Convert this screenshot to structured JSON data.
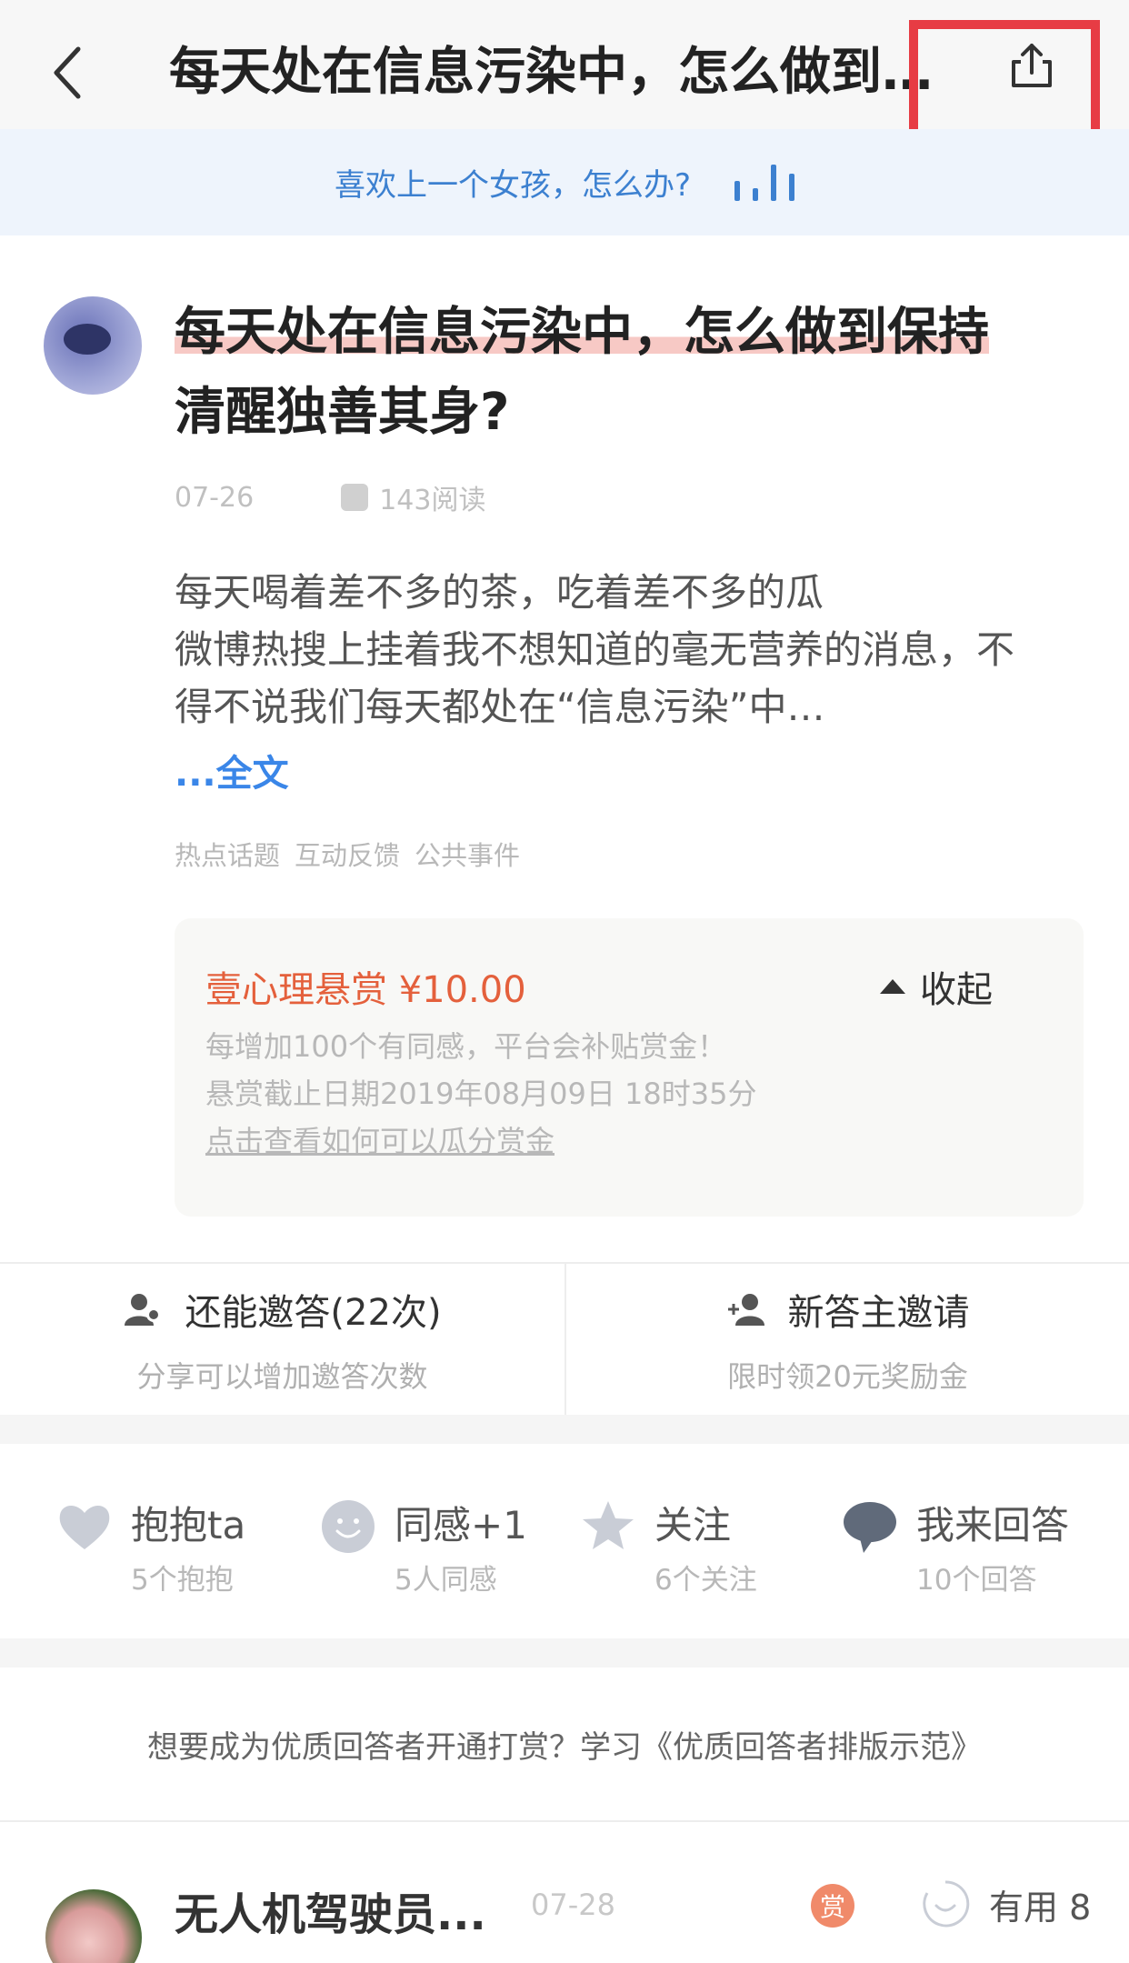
{
  "nav": {
    "title": "每天处在信息污染中，怎么做到保持清醒独善其身？",
    "back_icon": "chevron-left-icon",
    "share_icon": "share-icon",
    "highlight_color": "#e73c44"
  },
  "banner": {
    "text": "喜欢上一个女孩，怎么办?",
    "icon": "audio-bars-icon"
  },
  "question": {
    "title_line1": "每天处在信息污染中，怎么做到保持",
    "title_line2": "清醒独善其身?",
    "date": "07-26",
    "reads": "143阅读",
    "content_line1": "每天喝着差不多的茶，吃着差不多的瓜",
    "content_line2": "微博热搜上挂着我不想知道的毫无营养的消息，不",
    "content_line3": "得不说我们每天都处在“信息污染”中…",
    "fulltext_link": "...全文",
    "tags": [
      "热点话题",
      "互动反馈",
      "公共事件"
    ]
  },
  "reward": {
    "title": "壹心理悬赏 ¥10.00",
    "collapse_label": "收起",
    "line1": "每增加100个有同感，平台会补贴赏金！",
    "line2": "悬赏截止日期2019年08月09日 18时35分",
    "link": "点击查看如何可以瓜分赏金",
    "accent": "#e4603c"
  },
  "invite": {
    "left_label": "还能邀答(22次)",
    "left_sub": "分享可以增加邀答次数",
    "right_label": "新答主邀请",
    "right_sub": "限时领20元奖励金"
  },
  "actions": [
    {
      "label": "抱抱ta",
      "sub": "5个抱抱",
      "icon": "heart-icon"
    },
    {
      "label": "同感+1",
      "sub": "5人同感",
      "icon": "smile-icon"
    },
    {
      "label": "关注",
      "sub": "6个关注",
      "icon": "star-icon"
    },
    {
      "label": "我来回答",
      "sub": "10个回答",
      "icon": "comment-icon"
    }
  ],
  "learn": {
    "text": "想要成为优质回答者开通打赏？学习《优质回答者排版示范》"
  },
  "answer": {
    "name": "无人机驾驶员...",
    "date": "07-28",
    "reward_badge": "赏",
    "useful_label": "有用 8"
  }
}
